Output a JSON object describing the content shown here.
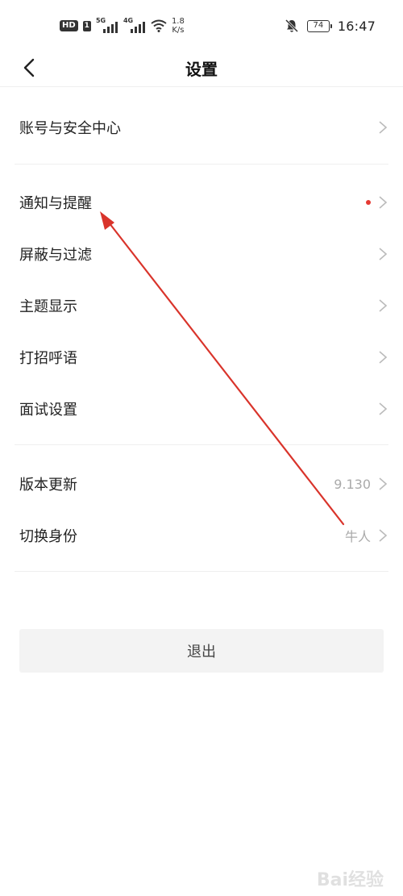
{
  "status_bar": {
    "hd": "HD",
    "sim": "1",
    "net1": "5G",
    "net2": "4G",
    "speed_value": "1.8",
    "speed_unit": "K/s",
    "battery": "74",
    "time": "16:47"
  },
  "nav": {
    "title": "设置"
  },
  "groups": [
    {
      "items": [
        {
          "label": "账号与安全中心",
          "value": ""
        }
      ]
    },
    {
      "items": [
        {
          "label": "通知与提醒",
          "value": "",
          "badge": true
        },
        {
          "label": "屏蔽与过滤",
          "value": ""
        },
        {
          "label": "主题显示",
          "value": ""
        },
        {
          "label": "打招呼语",
          "value": ""
        },
        {
          "label": "面试设置",
          "value": ""
        }
      ]
    },
    {
      "items": [
        {
          "label": "版本更新",
          "value": "9.130"
        },
        {
          "label": "切换身份",
          "value": "牛人"
        }
      ]
    }
  ],
  "logout": {
    "label": "退出"
  },
  "watermark": "Bai经验",
  "colors": {
    "badge": "#e53a33",
    "annotation_arrow": "#d9342b"
  }
}
